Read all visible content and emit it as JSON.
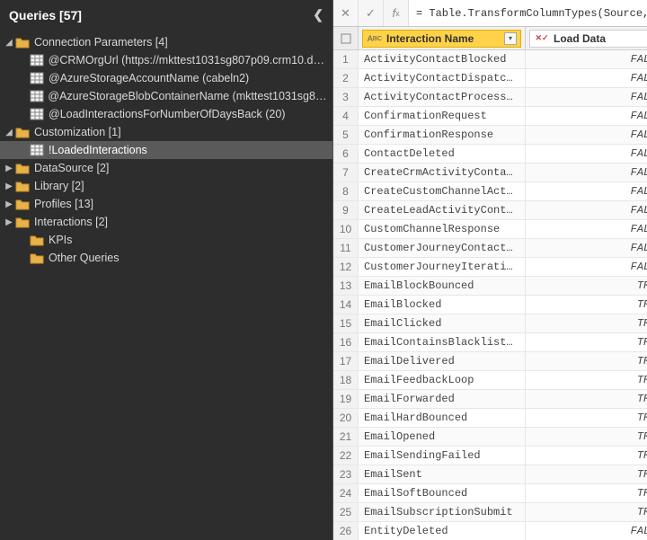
{
  "sidebar": {
    "title": "Queries [57]",
    "tree": [
      {
        "level": 0,
        "type": "folder",
        "expanded": true,
        "label": "Connection Parameters [4]"
      },
      {
        "level": 1,
        "type": "table",
        "label": "@CRMOrgUrl (https://mkttest1031sg807p09.crm10.dy…"
      },
      {
        "level": 1,
        "type": "table",
        "label": "@AzureStorageAccountName (cabeln2)"
      },
      {
        "level": 1,
        "type": "table",
        "label": "@AzureStorageBlobContainerName (mkttest1031sg80…"
      },
      {
        "level": 1,
        "type": "table",
        "label": "@LoadInteractionsForNumberOfDaysBack (20)"
      },
      {
        "level": 0,
        "type": "folder",
        "expanded": true,
        "label": "Customization [1]"
      },
      {
        "level": 1,
        "type": "table",
        "selected": true,
        "label": "!LoadedInteractions"
      },
      {
        "level": 0,
        "type": "folder",
        "expanded": false,
        "label": "DataSource [2]"
      },
      {
        "level": 0,
        "type": "folder",
        "expanded": false,
        "label": "Library [2]"
      },
      {
        "level": 0,
        "type": "folder",
        "expanded": false,
        "label": "Profiles [13]"
      },
      {
        "level": 0,
        "type": "folder",
        "expanded": false,
        "label": "Interactions [2]"
      },
      {
        "level": 1,
        "type": "folder-plain",
        "label": "KPIs"
      },
      {
        "level": 1,
        "type": "folder-plain",
        "label": "Other Queries"
      }
    ]
  },
  "formula": "= Table.TransformColumnTypes(Source,{{",
  "grid": {
    "columns": [
      {
        "type": "ABC",
        "name": "Interaction Name"
      },
      {
        "type": "XY",
        "name": "Load Data"
      }
    ],
    "rows": [
      {
        "n": 1,
        "c1": "ActivityContactBlocked",
        "c2": "FALSE"
      },
      {
        "n": 2,
        "c1": "ActivityContactDispatc…",
        "c2": "FALSE"
      },
      {
        "n": 3,
        "c1": "ActivityContactProcess…",
        "c2": "FALSE"
      },
      {
        "n": 4,
        "c1": "ConfirmationRequest",
        "c2": "FALSE"
      },
      {
        "n": 5,
        "c1": "ConfirmationResponse",
        "c2": "FALSE"
      },
      {
        "n": 6,
        "c1": "ContactDeleted",
        "c2": "FALSE"
      },
      {
        "n": 7,
        "c1": "CreateCrmActivityConta…",
        "c2": "FALSE"
      },
      {
        "n": 8,
        "c1": "CreateCustomChannelAct…",
        "c2": "FALSE"
      },
      {
        "n": 9,
        "c1": "CreateLeadActivityCont…",
        "c2": "FALSE"
      },
      {
        "n": 10,
        "c1": "CustomChannelResponse",
        "c2": "FALSE"
      },
      {
        "n": 11,
        "c1": "CustomerJourneyContact…",
        "c2": "FALSE"
      },
      {
        "n": 12,
        "c1": "CustomerJourneyIterati…",
        "c2": "FALSE"
      },
      {
        "n": 13,
        "c1": "EmailBlockBounced",
        "c2": "TRUE"
      },
      {
        "n": 14,
        "c1": "EmailBlocked",
        "c2": "TRUE"
      },
      {
        "n": 15,
        "c1": "EmailClicked",
        "c2": "TRUE"
      },
      {
        "n": 16,
        "c1": "EmailContainsBlacklist…",
        "c2": "TRUE"
      },
      {
        "n": 17,
        "c1": "EmailDelivered",
        "c2": "TRUE"
      },
      {
        "n": 18,
        "c1": "EmailFeedbackLoop",
        "c2": "TRUE"
      },
      {
        "n": 19,
        "c1": "EmailForwarded",
        "c2": "TRUE"
      },
      {
        "n": 20,
        "c1": "EmailHardBounced",
        "c2": "TRUE"
      },
      {
        "n": 21,
        "c1": "EmailOpened",
        "c2": "TRUE"
      },
      {
        "n": 22,
        "c1": "EmailSendingFailed",
        "c2": "TRUE"
      },
      {
        "n": 23,
        "c1": "EmailSent",
        "c2": "TRUE"
      },
      {
        "n": 24,
        "c1": "EmailSoftBounced",
        "c2": "TRUE"
      },
      {
        "n": 25,
        "c1": "EmailSubscriptionSubmit",
        "c2": "TRUE"
      },
      {
        "n": 26,
        "c1": "EntityDeleted",
        "c2": "FALSE"
      }
    ]
  }
}
